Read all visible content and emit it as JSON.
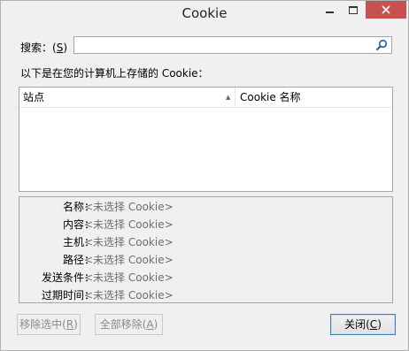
{
  "window": {
    "title": "Cookie",
    "close_color": "#c75050"
  },
  "search": {
    "label_prefix": "搜索：(",
    "label_key": "S",
    "label_suffix": ")",
    "value": "",
    "placeholder": "",
    "icon": "search-icon"
  },
  "list": {
    "caption": "以下是在您的计算机上存储的 Cookie：",
    "col_site": "站点",
    "col_name": "Cookie 名称",
    "rows": []
  },
  "details": {
    "rows": [
      {
        "label": "名称：",
        "value": "<未选择 Cookie>"
      },
      {
        "label": "内容：",
        "value": "<未选择 Cookie>"
      },
      {
        "label": "主机：",
        "value": "<未选择 Cookie>"
      },
      {
        "label": "路径：",
        "value": "<未选择 Cookie>"
      },
      {
        "label": "发送条件：",
        "value": "<未选择 Cookie>"
      },
      {
        "label": "过期时间：",
        "value": "<未选择 Cookie>"
      }
    ]
  },
  "buttons": {
    "remove_prefix": "移除选中(",
    "remove_key": "R",
    "remove_suffix": ")",
    "removeall_prefix": "全部移除(",
    "removeall_key": "A",
    "removeall_suffix": ")",
    "close_prefix": "关闭(",
    "close_key": "C",
    "close_suffix": ")"
  }
}
